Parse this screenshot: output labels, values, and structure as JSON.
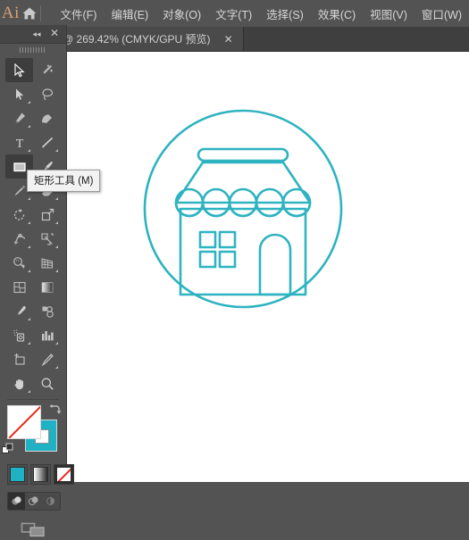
{
  "app": {
    "logo_text": "Ai",
    "home_icon": "home-icon"
  },
  "menubar": {
    "items": [
      {
        "label": "文件(F)",
        "name": "menu-file"
      },
      {
        "label": "编辑(E)",
        "name": "menu-edit"
      },
      {
        "label": "对象(O)",
        "name": "menu-object"
      },
      {
        "label": "文字(T)",
        "name": "menu-type"
      },
      {
        "label": "选择(S)",
        "name": "menu-select"
      },
      {
        "label": "效果(C)",
        "name": "menu-effect"
      },
      {
        "label": "视图(V)",
        "name": "menu-view"
      },
      {
        "label": "窗口(W)",
        "name": "menu-window"
      }
    ]
  },
  "document_tab": {
    "title": "@ 269.42% (CMYK/GPU 预览)",
    "zoom_percent": "269.42%",
    "color_mode": "CMYK",
    "render_mode": "GPU 预览",
    "close_label": "✕"
  },
  "tool_panel": {
    "collapse_label": "◂◂",
    "close_label": "✕",
    "tools": [
      {
        "name": "selection-tool",
        "key": "V",
        "active": true,
        "corner": false
      },
      {
        "name": "magic-wand-tool",
        "key": "Y",
        "active": false,
        "corner": false
      },
      {
        "name": "direct-selection-tool",
        "key": "A",
        "active": false,
        "corner": true
      },
      {
        "name": "lasso-tool",
        "key": "Q",
        "active": false,
        "corner": false
      },
      {
        "name": "pen-tool",
        "key": "P",
        "active": false,
        "corner": true
      },
      {
        "name": "curvature-tool",
        "key": "shift-tilde",
        "active": false,
        "corner": false
      },
      {
        "name": "type-tool",
        "key": "T",
        "active": false,
        "corner": true
      },
      {
        "name": "line-segment-tool",
        "key": "backslash",
        "active": false,
        "corner": true
      },
      {
        "name": "rectangle-tool",
        "key": "M",
        "active": true,
        "corner": true
      },
      {
        "name": "paintbrush-tool",
        "key": "B",
        "active": false,
        "corner": true
      },
      {
        "name": "shaper-tool",
        "key": "shift-N",
        "active": false,
        "corner": true
      },
      {
        "name": "eraser-tool",
        "key": "shift-E",
        "active": false,
        "corner": true
      },
      {
        "name": "rotate-tool",
        "key": "R",
        "active": false,
        "corner": true
      },
      {
        "name": "scale-tool",
        "key": "S",
        "active": false,
        "corner": true
      },
      {
        "name": "width-tool",
        "key": "shift-W",
        "active": false,
        "corner": true
      },
      {
        "name": "free-transform-tool",
        "key": "E",
        "active": false,
        "corner": true
      },
      {
        "name": "shape-builder-tool",
        "key": "shift-M",
        "active": false,
        "corner": true
      },
      {
        "name": "perspective-grid-tool",
        "key": "shift-P",
        "active": false,
        "corner": true
      },
      {
        "name": "mesh-tool",
        "key": "U",
        "active": false,
        "corner": false
      },
      {
        "name": "gradient-tool",
        "key": "G",
        "active": false,
        "corner": false
      },
      {
        "name": "eyedropper-tool",
        "key": "I",
        "active": false,
        "corner": true
      },
      {
        "name": "blend-tool",
        "key": "W",
        "active": false,
        "corner": false
      },
      {
        "name": "symbol-sprayer-tool",
        "key": "shift-S",
        "active": false,
        "corner": true
      },
      {
        "name": "column-graph-tool",
        "key": "J",
        "active": false,
        "corner": true
      },
      {
        "name": "artboard-tool",
        "key": "shift-O",
        "active": false,
        "corner": false
      },
      {
        "name": "slice-tool",
        "key": "shift-K",
        "active": false,
        "corner": true
      },
      {
        "name": "hand-tool",
        "key": "H",
        "active": false,
        "corner": true
      },
      {
        "name": "zoom-tool",
        "key": "Z",
        "active": false,
        "corner": false
      }
    ],
    "fill_label": "无",
    "stroke_label": "描边",
    "color_modes": [
      {
        "name": "color-mode-solid",
        "label": "颜色",
        "selected": false
      },
      {
        "name": "color-mode-gradient",
        "label": "渐变",
        "selected": false
      },
      {
        "name": "color-mode-none",
        "label": "无",
        "selected": true
      }
    ],
    "draw_modes": [
      {
        "name": "draw-normal-mode",
        "label": "正常绘图",
        "active": true
      },
      {
        "name": "draw-behind-mode",
        "label": "背面绘图",
        "active": false
      },
      {
        "name": "draw-inside-mode",
        "label": "内部绘图",
        "active": false
      }
    ],
    "screen_mode_label": "更改屏幕模式"
  },
  "tooltip": {
    "text": "矩形工具 (M)"
  },
  "colors": {
    "stroke": "#1fb2c4",
    "fill": "none",
    "artwork_stroke": "#2eb3c0",
    "panel_bg": "#535353",
    "canvas_bg": "#ffffff",
    "logo": "#d8a070"
  },
  "artwork": {
    "name": "shop-storefront-icon",
    "description": "线性商店图标：圆环内含带遮阳篷的店铺，左侧四格窗户，右侧拱形门"
  }
}
